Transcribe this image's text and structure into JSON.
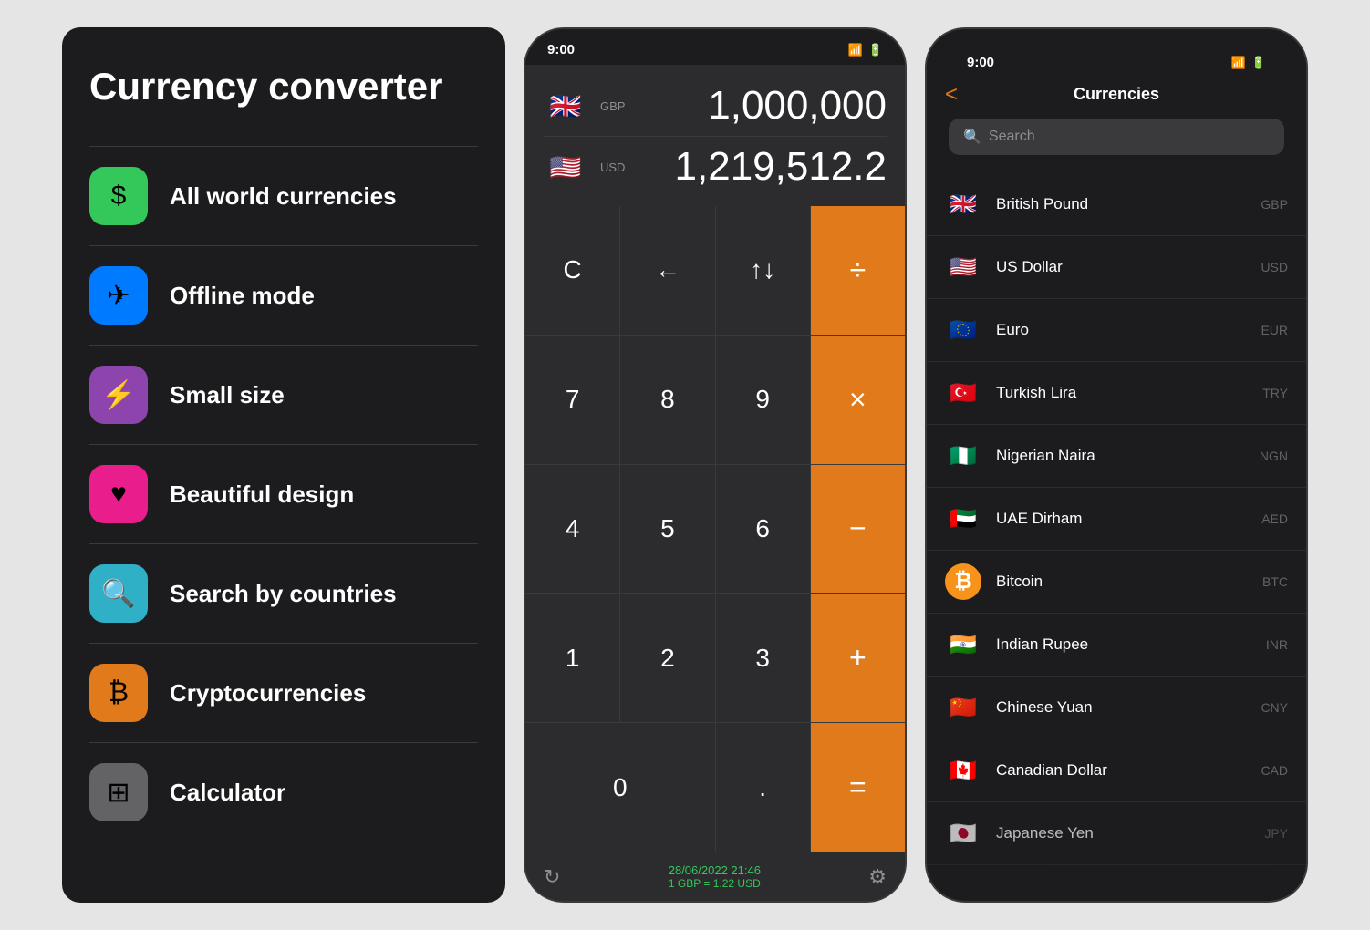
{
  "features": {
    "title": "Currency converter",
    "items": [
      {
        "id": "all-currencies",
        "label": "All world currencies",
        "iconClass": "icon-green",
        "icon": "$"
      },
      {
        "id": "offline-mode",
        "label": "Offline mode",
        "iconClass": "icon-blue",
        "icon": "✈"
      },
      {
        "id": "small-size",
        "label": "Small size",
        "iconClass": "icon-purple",
        "icon": "⚡"
      },
      {
        "id": "beautiful-design",
        "label": "Beautiful design",
        "iconClass": "icon-pink",
        "icon": "♥"
      },
      {
        "id": "search-countries",
        "label": "Search by countries",
        "iconClass": "icon-teal",
        "icon": "🔍"
      },
      {
        "id": "cryptocurrencies",
        "label": "Cryptocurrencies",
        "iconClass": "icon-orange",
        "icon": "₿"
      },
      {
        "id": "calculator",
        "label": "Calculator",
        "iconClass": "icon-gray",
        "icon": "⊞"
      }
    ]
  },
  "calculator": {
    "status_time": "9:00",
    "from_currency": "GBP",
    "from_amount": "1,000,000",
    "to_currency": "USD",
    "to_amount": "1,219,512.2",
    "keys": [
      "C",
      "←",
      "↑↓",
      "÷",
      "7",
      "8",
      "9",
      "×",
      "4",
      "5",
      "6",
      "−",
      "1",
      "2",
      "3",
      "+",
      "0",
      ".",
      "="
    ],
    "footer_date": "28/06/2022 21:46",
    "footer_rate": "1 GBP = 1.22 USD"
  },
  "currencies": {
    "status_time": "9:00",
    "title": "Currencies",
    "back_label": "<",
    "search_placeholder": "Search",
    "list": [
      {
        "name": "British Pound",
        "code": "GBP",
        "flagEmoji": "🇬🇧"
      },
      {
        "name": "US Dollar",
        "code": "USD",
        "flagEmoji": "🇺🇸"
      },
      {
        "name": "Euro",
        "code": "EUR",
        "flagEmoji": "🇪🇺"
      },
      {
        "name": "Turkish Lira",
        "code": "TRY",
        "flagEmoji": "🇹🇷"
      },
      {
        "name": "Nigerian Naira",
        "code": "NGN",
        "flagEmoji": "🇳🇬"
      },
      {
        "name": "UAE Dirham",
        "code": "AED",
        "flagEmoji": "🇦🇪"
      },
      {
        "name": "Bitcoin",
        "code": "BTC",
        "flagEmoji": "₿"
      },
      {
        "name": "Indian Rupee",
        "code": "INR",
        "flagEmoji": "🇮🇳"
      },
      {
        "name": "Chinese Yuan",
        "code": "CNY",
        "flagEmoji": "🇨🇳"
      },
      {
        "name": "Canadian Dollar",
        "code": "CAD",
        "flagEmoji": "🇨🇦"
      },
      {
        "name": "Japanese Yen",
        "code": "JPY",
        "flagEmoji": "🇯🇵"
      }
    ]
  }
}
